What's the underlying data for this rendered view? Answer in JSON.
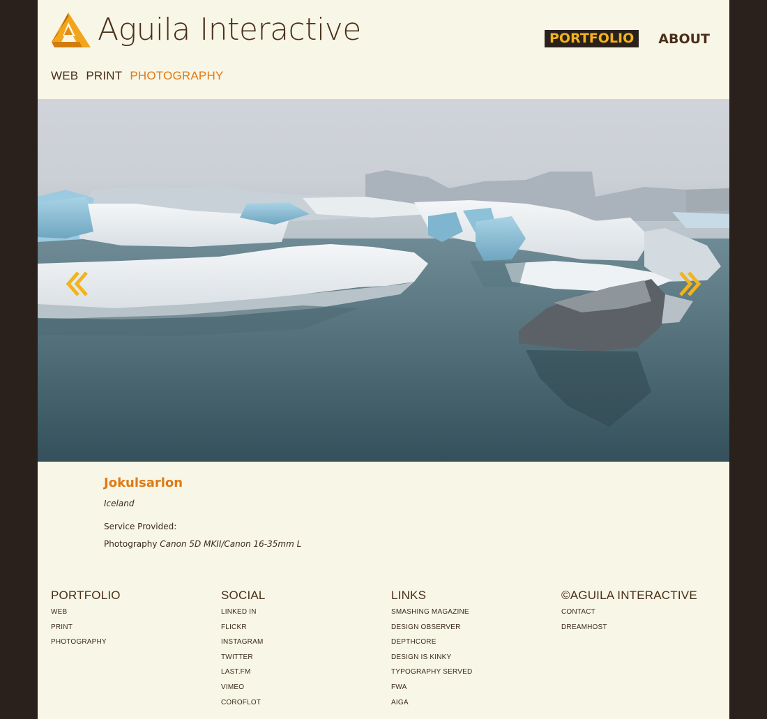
{
  "header": {
    "logo_text": "Aguila Interactive",
    "nav": [
      {
        "label": "PORTFOLIO",
        "active": true
      },
      {
        "label": "ABOUT",
        "active": false
      }
    ],
    "subnav": [
      {
        "label": "WEB",
        "active": false
      },
      {
        "label": "PRINT",
        "active": false
      },
      {
        "label": "PHOTOGRAPHY",
        "active": true
      }
    ]
  },
  "hero": {
    "prev_icon": "double-chevron-left-icon",
    "next_icon": "double-chevron-right-icon"
  },
  "project": {
    "title": "Jokulsarlon",
    "location": "Iceland",
    "service_label": "Service Provided:",
    "service": "Photography",
    "equipment": "Canon 5D MKII/Canon 16-35mm L"
  },
  "footer": {
    "columns": [
      {
        "heading": "PORTFOLIO",
        "links": [
          "WEB",
          "PRINT",
          "PHOTOGRAPHY"
        ]
      },
      {
        "heading": "SOCIAL",
        "links": [
          "LINKED IN",
          "FLICKR",
          "INSTAGRAM",
          "TWITTER",
          "LAST.FM",
          "VIMEO",
          "COROFLOT"
        ]
      },
      {
        "heading": "LINKS",
        "links": [
          "SMASHING MAGAZINE",
          "DESIGN OBSERVER",
          "DEPTHCORE",
          "DESIGN IS KINKY",
          "TYPOGRAPHY SERVED",
          "FWA",
          "AIGA"
        ]
      },
      {
        "heading": "©AGUILA INTERACTIVE",
        "links": [
          "CONTACT",
          "DREAMHOST"
        ]
      }
    ]
  },
  "colors": {
    "page_bg": "#f8f6e6",
    "outer_bg": "#2a211d",
    "text_brown": "#4a2f1a",
    "accent_orange": "#e07a12",
    "accent_yellow": "#f2b31b"
  }
}
